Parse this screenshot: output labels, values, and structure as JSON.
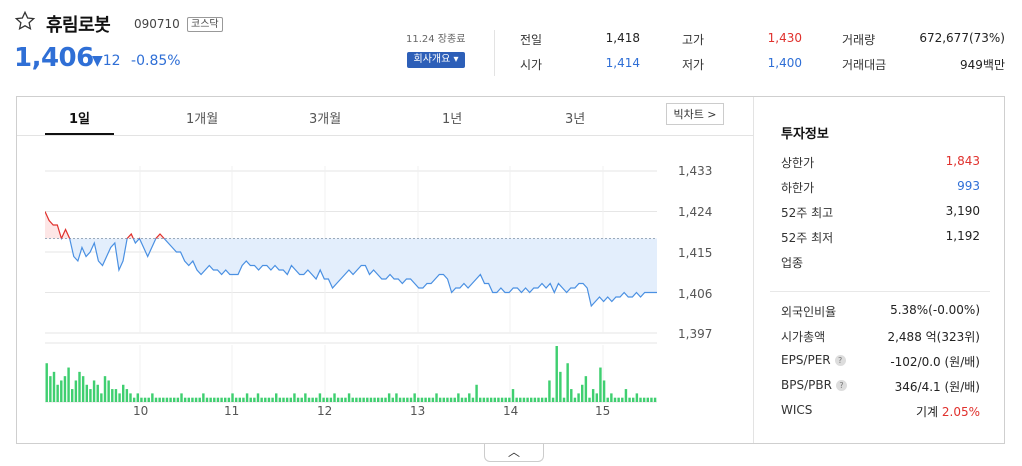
{
  "stock": {
    "name": "휴림로봇",
    "code": "090710",
    "market": "코스닥",
    "price": "1,406",
    "change": "▼12",
    "change_pct": "-0.85%"
  },
  "header": {
    "date": "11.24 장종료",
    "company_button": "회사개요 ▾"
  },
  "quote": [
    {
      "label": "전일",
      "value": "1,418",
      "color": "#222222"
    },
    {
      "label": "시가",
      "value": "1,414",
      "color": "#2f6fd6"
    },
    {
      "label": "고가",
      "value": "1,430",
      "color": "#e0312d"
    },
    {
      "label": "저가",
      "value": "1,400",
      "color": "#2f6fd6"
    },
    {
      "label": "거래량",
      "value": "672,677(73%)",
      "color": "#222222"
    },
    {
      "label": "거래대금",
      "value": "949백만",
      "color": "#222222"
    }
  ],
  "tabs": [
    "1일",
    "1개월",
    "3개월",
    "1년",
    "3년"
  ],
  "big_chart_button": "빅차트 >",
  "info": {
    "title": "투자정보",
    "rows_top": [
      {
        "label": "상한가",
        "value": "1,843",
        "color": "#e0312d"
      },
      {
        "label": "하한가",
        "value": "993",
        "color": "#2f6fd6"
      },
      {
        "label": "52주 최고",
        "value": "3,190",
        "color": "#222222"
      },
      {
        "label": "52주 최저",
        "value": "1,192",
        "color": "#222222"
      },
      {
        "label": "업종",
        "value": "",
        "color": "#222222"
      }
    ],
    "rows_bottom": [
      {
        "label": "외국인비율",
        "value": "5.38%(-0.00%)"
      },
      {
        "label": "시가총액",
        "value": "2,488 억(323위)"
      },
      {
        "label": "EPS/PER",
        "value": "-102/0.0 (원/배)"
      },
      {
        "label": "BPS/PBR",
        "value": "346/4.1 (원/배)"
      },
      {
        "label": "WICS",
        "value": "기계",
        "extra": "2.05%"
      }
    ]
  },
  "chart_data": {
    "type": "line",
    "y_ticks": [
      "1,433",
      "1,424",
      "1,415",
      "1,406",
      "1,397"
    ],
    "ylim": [
      1397,
      1433
    ],
    "x_ticks": [
      "10",
      "11",
      "12",
      "13",
      "14",
      "15"
    ],
    "prev_close": 1418,
    "series": [
      {
        "values": [
          1424,
          1422,
          1421,
          1421,
          1418,
          1420,
          1418,
          1414,
          1413,
          1416,
          1414,
          1415,
          1417,
          1413,
          1412,
          1414,
          1416,
          1417,
          1411,
          1413,
          1418,
          1419,
          1417,
          1418,
          1416,
          1414,
          1416,
          1418,
          1419,
          1418,
          1417,
          1416,
          1415,
          1415,
          1413,
          1412,
          1413,
          1411,
          1410,
          1411,
          1412,
          1411,
          1411,
          1410,
          1411,
          1410,
          1410,
          1410,
          1412,
          1413,
          1412,
          1412,
          1411,
          1412,
          1412,
          1411,
          1412,
          1411,
          1411,
          1410,
          1412,
          1411,
          1410,
          1410,
          1411,
          1410,
          1409,
          1411,
          1409,
          1409,
          1407,
          1408,
          1409,
          1410,
          1411,
          1410,
          1411,
          1412,
          1412,
          1410,
          1411,
          1410,
          1409,
          1409,
          1410,
          1409,
          1409,
          1408,
          1409,
          1409,
          1408,
          1407,
          1407,
          1408,
          1408,
          1409,
          1410,
          1410,
          1409,
          1406,
          1407,
          1407,
          1408,
          1407,
          1408,
          1409,
          1410,
          1408,
          1408,
          1406,
          1406,
          1407,
          1406,
          1406,
          1407,
          1407,
          1406,
          1407,
          1406,
          1407,
          1407,
          1408,
          1407,
          1408,
          1406,
          1408,
          1407,
          1406,
          1407,
          1407,
          1408,
          1408,
          1407,
          1403,
          1404,
          1405,
          1404,
          1405,
          1404,
          1405,
          1405,
          1406,
          1405,
          1405,
          1406,
          1405,
          1406,
          1406,
          1406,
          1406
        ]
      }
    ],
    "volume": [
      9,
      6,
      7,
      4,
      5,
      6,
      8,
      3,
      5,
      7,
      6,
      4,
      3,
      5,
      4,
      2,
      6,
      5,
      3,
      3,
      2,
      4,
      3,
      2,
      1,
      2,
      1,
      1,
      1,
      2,
      1,
      1,
      1,
      1,
      1,
      1,
      1,
      2,
      1,
      1,
      1,
      1,
      1,
      2,
      1,
      1,
      1,
      1,
      1,
      1,
      1,
      2,
      1,
      1,
      1,
      2,
      1,
      1,
      2,
      1,
      1,
      1,
      1,
      2,
      1,
      1,
      1,
      1,
      2,
      1,
      1,
      2,
      1,
      1,
      1,
      2,
      1,
      1,
      1,
      2,
      1,
      1,
      1,
      2,
      1,
      1,
      1,
      1,
      1,
      1,
      1,
      1,
      1,
      1,
      2,
      1,
      2,
      1,
      1,
      1,
      1,
      2,
      1,
      1,
      1,
      1,
      1,
      2,
      1,
      1,
      1,
      1,
      1,
      2,
      1,
      1,
      2,
      1,
      4,
      1,
      1,
      1,
      1,
      1,
      1,
      1,
      1,
      1,
      3,
      1,
      1,
      1,
      1,
      1,
      1,
      1,
      1,
      1,
      5,
      1,
      13,
      7,
      1,
      9,
      3,
      1,
      2,
      4,
      6,
      1,
      3,
      2,
      8,
      5,
      1,
      2,
      1,
      1,
      1,
      3,
      1,
      1,
      2,
      1,
      1,
      1,
      1,
      1
    ]
  }
}
